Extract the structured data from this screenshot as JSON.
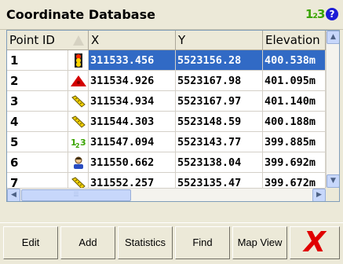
{
  "window": {
    "title": "Coordinate Database",
    "numeric_mode": "1₂3",
    "help": "?"
  },
  "table": {
    "columns": [
      "Point ID",
      "",
      "X",
      "Y",
      "Elevation"
    ],
    "rows": [
      {
        "id": "1",
        "icon": "traffic-light-icon",
        "x": "311533.456",
        "y": "5523156.28",
        "elev": "400.538m",
        "selected": true
      },
      {
        "id": "2",
        "icon": "red-triangle-icon",
        "x": "311534.926",
        "y": "5523167.98",
        "elev": "401.095m"
      },
      {
        "id": "3",
        "icon": "ruler-icon",
        "x": "311534.934",
        "y": "5523167.97",
        "elev": "401.140m"
      },
      {
        "id": "4",
        "icon": "ruler-icon",
        "x": "311544.303",
        "y": "5523148.59",
        "elev": "400.188m"
      },
      {
        "id": "5",
        "icon": "numeric-icon",
        "x": "311547.094",
        "y": "5523143.77",
        "elev": "399.885m"
      },
      {
        "id": "6",
        "icon": "person-icon",
        "x": "311550.662",
        "y": "5523138.04",
        "elev": "399.692m"
      },
      {
        "id": "7",
        "icon": "ruler-icon",
        "x": "311552.257",
        "y": "5523135.47",
        "elev": "399.672m"
      }
    ]
  },
  "toolbar": {
    "edit": "Edit",
    "add": "Add",
    "statistics": "Statistics",
    "find": "Find",
    "map_view": "Map View",
    "close_symbol": "X"
  },
  "colors": {
    "selection": "#316ac5",
    "accent_green": "#3aa400",
    "close_red": "#e00000"
  }
}
